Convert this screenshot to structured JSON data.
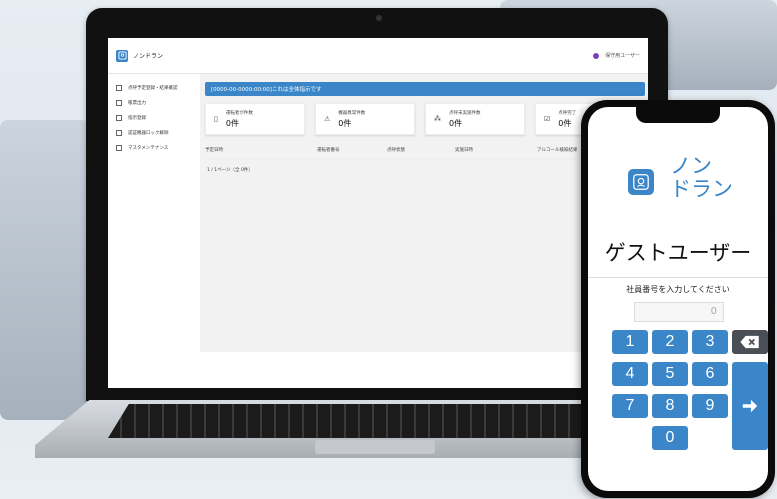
{
  "app": {
    "name": "ノンドラン",
    "user_label": "保守用ユーザー"
  },
  "sidebar": {
    "items": [
      {
        "label": "点呼予定登録・結果確認"
      },
      {
        "label": "帳票出力"
      },
      {
        "label": "指示登録"
      },
      {
        "label": "認証機器ロック解除"
      },
      {
        "label": "マスタメンテナンス"
      }
    ]
  },
  "main": {
    "banner": "[0000-00-0000:00:00]これは全体指示です",
    "cards": [
      {
        "label": "運転者が件数",
        "value": "0件",
        "icon": "calendar-icon"
      },
      {
        "label": "機器異常件数",
        "value": "0件",
        "icon": "warning-icon"
      },
      {
        "label": "点呼未実施件数",
        "value": "0件",
        "icon": "people-icon"
      },
      {
        "label": "点呼完了",
        "value": "0件",
        "icon": "check-icon"
      }
    ],
    "table": {
      "columns": [
        "予定日時",
        "運転者番号",
        "点呼状態",
        "実施日時",
        "アルコール検知結果"
      ]
    },
    "page_info": "1 / 1ページ（全 0件）"
  },
  "phone": {
    "brand_line1": "ノン",
    "brand_line2": "ドラン",
    "title": "ゲストユーザー",
    "prompt": "社員番号を入力してください",
    "input_value": "0",
    "keys": [
      "1",
      "2",
      "3",
      "4",
      "5",
      "6",
      "7",
      "8",
      "9",
      "0"
    ],
    "backspace_icon": "backspace-icon",
    "enter_icon": "arrow-right-icon"
  },
  "colors": {
    "accent": "#3a86c8",
    "user_dot": "#7b3fb8"
  }
}
